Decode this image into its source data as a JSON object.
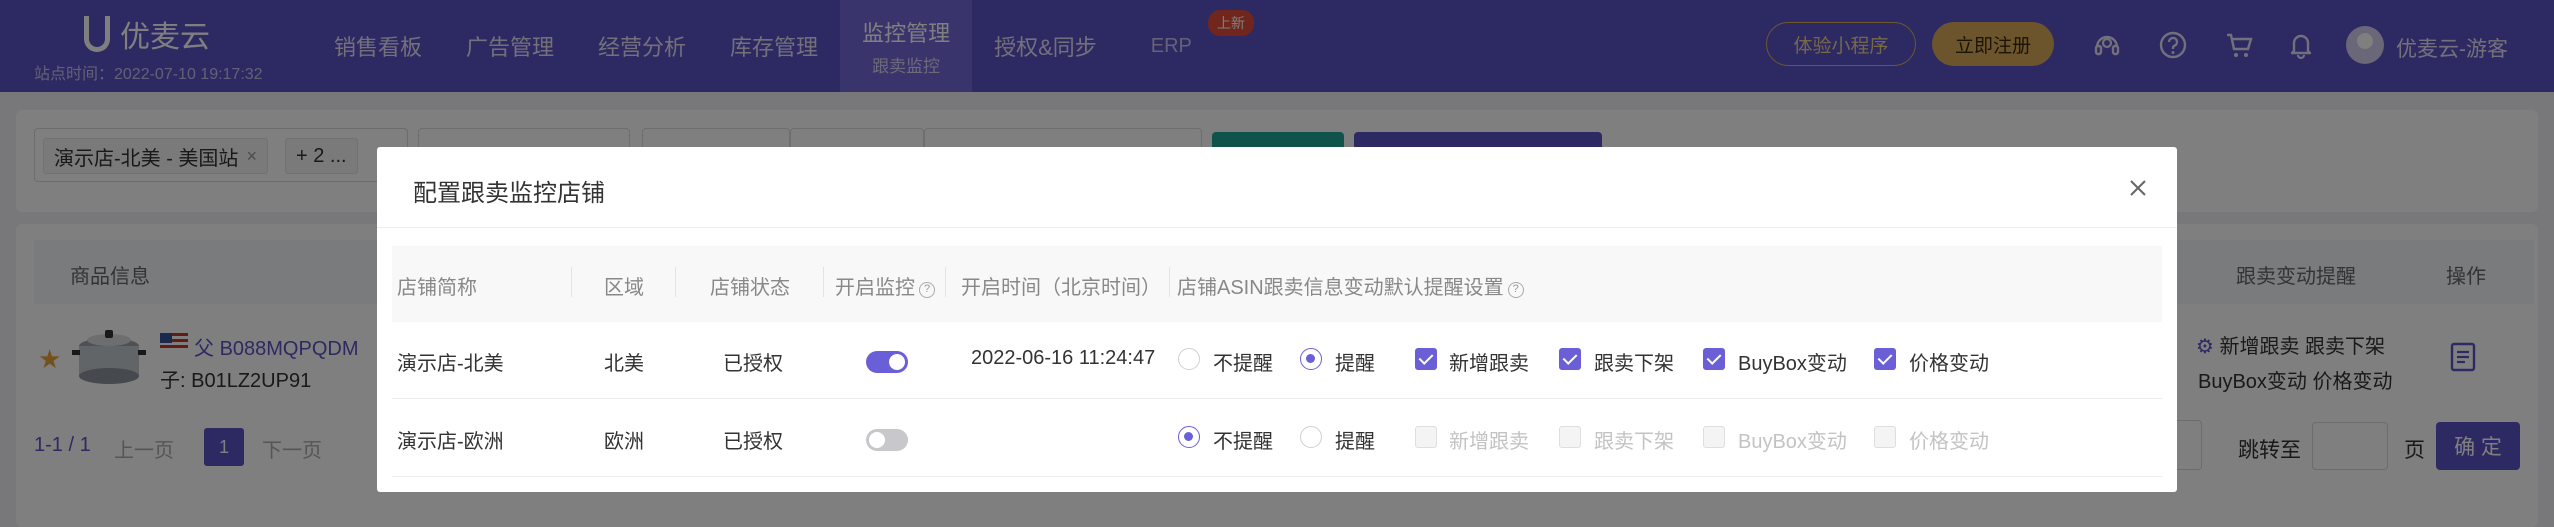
{
  "topbar": {
    "brand": "优麦云",
    "station_time": "站点时间：2022-07-10 19:17:32",
    "nav": [
      {
        "label": "销售看板"
      },
      {
        "label": "广告管理"
      },
      {
        "label": "经营分析"
      },
      {
        "label": "库存管理"
      },
      {
        "label": "监控管理",
        "sub": "跟卖监控",
        "active": true
      },
      {
        "label": "授权&同步"
      },
      {
        "label": "ERP",
        "badge": "上新"
      }
    ],
    "mini_program": "体验小程序",
    "register": "立即注册",
    "user_name": "优麦云-游客",
    "icons": [
      "headset-icon",
      "help-icon",
      "cart-icon",
      "bell-icon"
    ],
    "accent": "#5b52c5"
  },
  "page": {
    "store_tag": "演示店-北美 - 美国站",
    "store_more": "+ 2 ...",
    "columns": {
      "product": "商品信息",
      "alert": "跟卖变动提醒",
      "action": "操作"
    },
    "row": {
      "parent_label": "父",
      "parent_asin": "B088MQPQDM",
      "child_asin": "子: B01LZ2UP91",
      "alerts_line1": "新增跟卖 跟卖下架",
      "alerts_line2": "BuyBox变动 价格变动"
    },
    "pager": {
      "info": "1-1 / 1",
      "prev": "上一页",
      "current": "1",
      "next": "下一页",
      "jump": "跳转至",
      "page_unit": "页",
      "confirm": "确 定"
    }
  },
  "modal": {
    "title": "配置跟卖监控店铺",
    "headers": {
      "store": "店铺简称",
      "region": "区域",
      "status": "店铺状态",
      "monitor": "开启监控",
      "time": "开启时间（北京时间）",
      "settings": "店铺ASIN跟卖信息变动默认提醒设置"
    },
    "options": {
      "no_remind": "不提醒",
      "remind": "提醒",
      "new_seller": "新增跟卖",
      "seller_removed": "跟卖下架",
      "buybox": "BuyBox变动",
      "price": "价格变动"
    },
    "rows": [
      {
        "store": "演示店-北美",
        "region": "北美",
        "status": "已授权",
        "monitor_on": true,
        "time": "2022-06-16 11:24:47",
        "remind": true
      },
      {
        "store": "演示店-欧洲",
        "region": "欧洲",
        "status": "已授权",
        "monitor_on": false,
        "time": "",
        "remind": false
      }
    ]
  }
}
